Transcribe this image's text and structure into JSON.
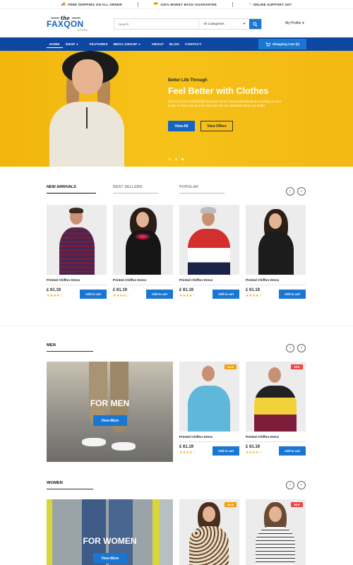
{
  "topbar": {
    "items": [
      {
        "icon": "truck-icon",
        "text": "FREE SHIPPING ON ALL ORDER"
      },
      {
        "icon": "money-icon",
        "text": "100% MONEY BACK GUARANTEE"
      },
      {
        "icon": "support-icon",
        "text": "ONLINE SUPPORT 24/7"
      }
    ]
  },
  "header": {
    "logo_the": "the",
    "logo_name": "FAXQON",
    "logo_store": "STORE",
    "search_placeholder": "Search",
    "category_label": "All Categories",
    "profile_label": "My Profile"
  },
  "nav": {
    "items": [
      "HOME",
      "SHOP",
      "FEATURES",
      "MEGA GROUP",
      "ABOUT",
      "BLOG",
      "CONTACT"
    ],
    "cart_label": "Shopping Cart (0)"
  },
  "hero": {
    "subtitle": "Better Life Through",
    "title": "Feel Better with Clothes",
    "description": "Join us to a fun and friendly fancy art current. Our professionals are working so hard to see us from your face fun develop! We are dedicated about our duties",
    "btn_primary": "View All",
    "btn_secondary": "View Offers"
  },
  "product_tabs": [
    "NEW ARRIVALS",
    "BEST SELLERS",
    "POPULAR"
  ],
  "products": [
    {
      "name": "Printed Chiffon Dress",
      "price": "£ 61.19",
      "rating": 4,
      "add": "Add to cart"
    },
    {
      "name": "Printed Chiffon Dress",
      "price": "£ 61.19",
      "rating": 4,
      "add": "Add to cart"
    },
    {
      "name": "Printed Chiffon Dress",
      "price": "£ 61.19",
      "rating": 4,
      "add": "Add to cart"
    },
    {
      "name": "Printed Chiffon Dress",
      "price": "£ 61.19",
      "rating": 4,
      "add": "Add to cart"
    }
  ],
  "men": {
    "title": "MEN",
    "banner_label": "FOR MEN",
    "banner_button": "View More",
    "products": [
      {
        "name": "Printed Chiffon Dress",
        "price": "£ 61.19",
        "rating": 4,
        "add": "Add to cart",
        "badge": "SALE"
      },
      {
        "name": "Printed Chiffon Dress",
        "price": "£ 61.19",
        "rating": 4,
        "add": "Add to cart",
        "badge": "NEW"
      }
    ]
  },
  "women": {
    "title": "WOMEN",
    "banner_label": "FOR WOMEN",
    "banner_button": "View More",
    "products": [
      {
        "badge": "SALE"
      },
      {
        "badge": "NEW"
      }
    ]
  },
  "colors": {
    "primary": "#1976d2",
    "nav": "#0d47a1",
    "hero": "#f4b90f",
    "star": "#f4a300"
  },
  "arrows": {
    "prev": "‹",
    "next": "›"
  }
}
